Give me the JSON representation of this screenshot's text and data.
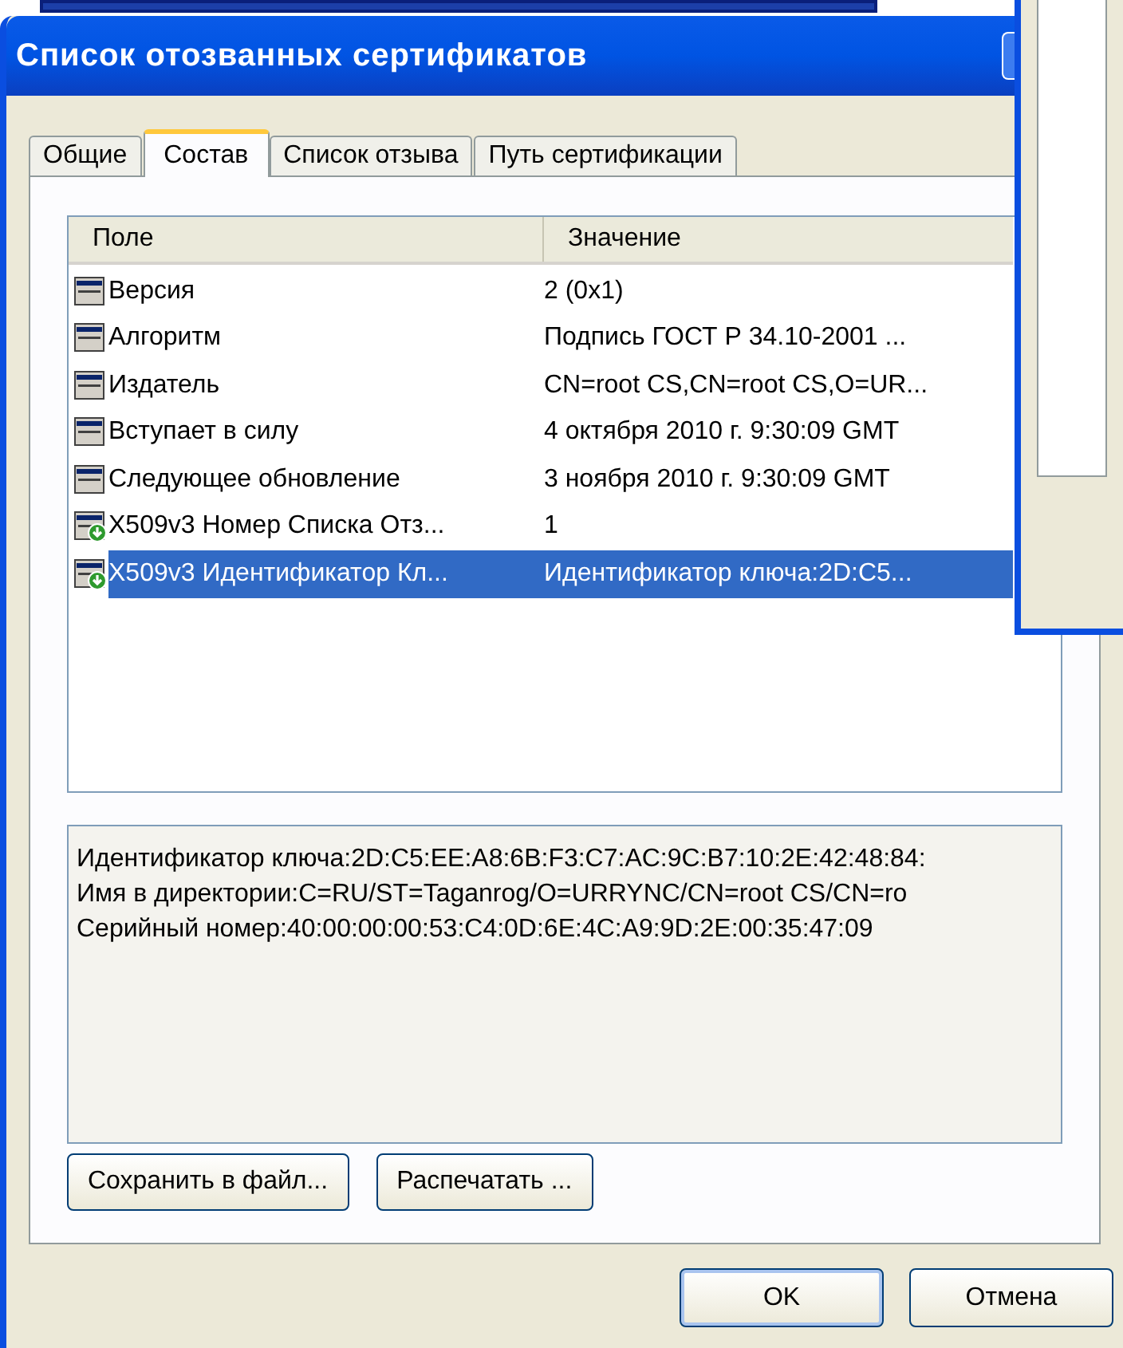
{
  "window": {
    "title": "Список отозванных сертификатов"
  },
  "tabs": [
    {
      "label": "Общие",
      "selected": false
    },
    {
      "label": "Состав",
      "selected": true
    },
    {
      "label": "Список отзыва",
      "selected": false
    },
    {
      "label": "Путь сертификации",
      "selected": false
    }
  ],
  "table": {
    "columns": [
      "Поле",
      "Значение"
    ],
    "rows": [
      {
        "kind": "basic",
        "field": "Версия",
        "value": "2 (0x1)",
        "selected": false
      },
      {
        "kind": "basic",
        "field": "Алгоритм",
        "value": "Подпись ГОСТ Р 34.10-2001 ...",
        "selected": false
      },
      {
        "kind": "basic",
        "field": "Издатель",
        "value": "CN=root CS,CN=root CS,O=UR...",
        "selected": false
      },
      {
        "kind": "basic",
        "field": "Вступает в силу",
        "value": "4 октября 2010 г. 9:30:09 GMT",
        "selected": false
      },
      {
        "kind": "basic",
        "field": "Следующее обновление",
        "value": "3 ноября 2010 г. 9:30:09 GMT",
        "selected": false
      },
      {
        "kind": "extension",
        "field": "X509v3 Номер Списка Отз...",
        "value": "1",
        "selected": false
      },
      {
        "kind": "extension",
        "field": "X509v3 Идентификатор Кл...",
        "value": "Идентификатор ключа:2D:C5...",
        "selected": true
      }
    ]
  },
  "details": [
    "Идентификатор ключа:2D:C5:EE:A8:6B:F3:C7:AC:9C:B7:10:2E:42:48:84:",
    "Имя в директории:C=RU/ST=Taganrog/O=URRYNC/CN=root CS/CN=ro",
    "Серийный номер:40:00:00:00:53:C4:0D:6E:4C:A9:9D:2E:00:35:47:09"
  ],
  "panel_buttons": [
    "Сохранить в файл...",
    "Распечатать ..."
  ],
  "dialog_buttons": [
    {
      "label": "OK",
      "kind": "default"
    },
    {
      "label": "Отмена",
      "kind": "normal"
    }
  ]
}
